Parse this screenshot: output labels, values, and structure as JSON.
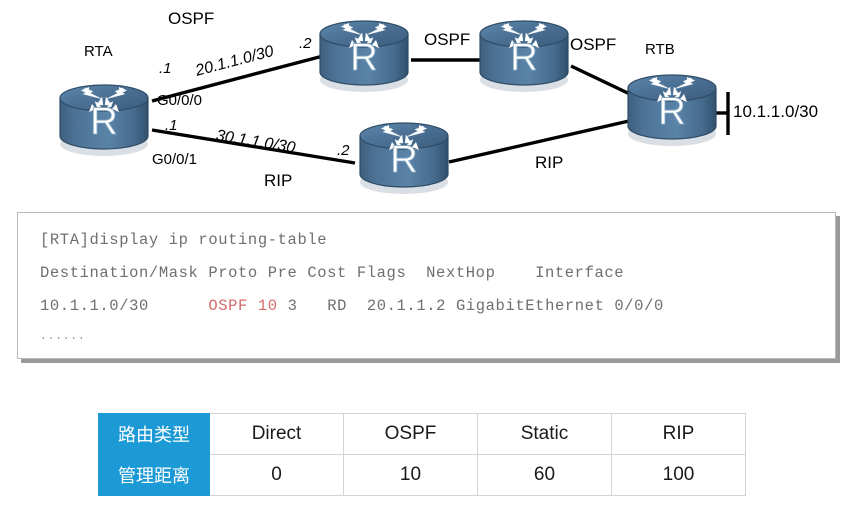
{
  "topology": {
    "routers": [
      {
        "id": "rta",
        "name": "RTA",
        "glyph": "R"
      },
      {
        "id": "top-mid",
        "name": "",
        "glyph": "R"
      },
      {
        "id": "top-right",
        "name": "",
        "glyph": "R"
      },
      {
        "id": "rtb",
        "name": "RTB",
        "glyph": "R"
      },
      {
        "id": "bottom",
        "name": "",
        "glyph": "R"
      }
    ],
    "labels": {
      "ospf_top": "OSPF",
      "ospf_mid": "OSPF",
      "ospf_right": "OSPF",
      "rip_bottom_left": "RIP",
      "rip_bottom_right": "RIP",
      "rta": "RTA",
      "rtb": "RTB",
      "iface_g000": "G0/0/0",
      "iface_g001": "G0/0/1",
      "dot1_upper": ".1",
      "dot1_lower": ".1",
      "dot2_upper": ".2",
      "dot2_lower": ".2",
      "subnet_upper": "20.1.1.0/30",
      "subnet_lower": "30.1.1.0/30",
      "stub_network": "10.1.1.0/30"
    }
  },
  "console": {
    "line1": "[RTA]display ip routing-table",
    "line2": "Destination/Mask Proto Pre Cost Flags  NextHop    Interface",
    "route": {
      "destination": "10.1.1.0/30",
      "proto": "OSPF",
      "pre": "10",
      "cost": "3",
      "flags": "RD",
      "nexthop": "20.1.1.2",
      "interface": "GigabitEthernet 0/0/0"
    },
    "ellipsis": "......"
  },
  "ad_table": {
    "row_labels": [
      "路由类型",
      "管理距离"
    ],
    "route_types": [
      "Direct",
      "OSPF",
      "Static",
      "RIP"
    ],
    "distances": [
      "0",
      "10",
      "60",
      "100"
    ],
    "header_color": "#1c9ad6"
  }
}
